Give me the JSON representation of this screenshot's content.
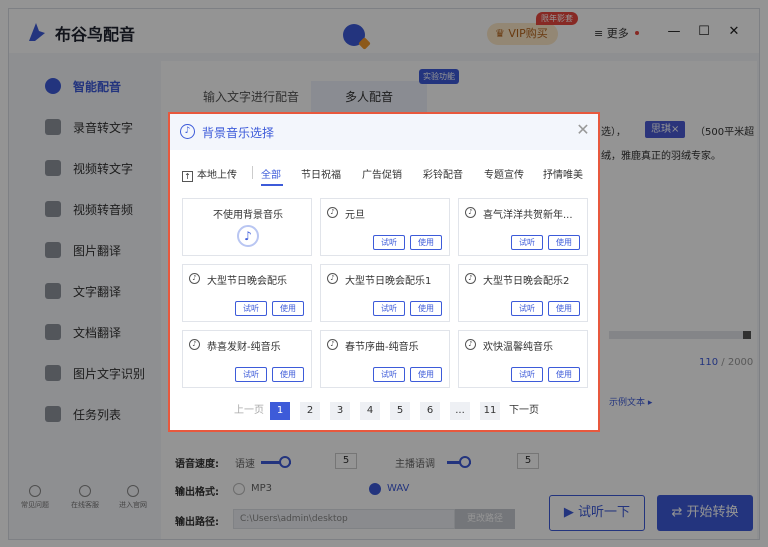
{
  "app": {
    "title": "布谷鸟配音",
    "vip_label": "VIP购买",
    "vip_tag": "限年影套",
    "more_label": "更多",
    "minimize": "—",
    "maximize": "☐",
    "close": "✕"
  },
  "sidebar": {
    "items": [
      {
        "label": "智能配音",
        "icon": "smart-dub-icon",
        "active": true
      },
      {
        "label": "录音转文字",
        "icon": "record-icon"
      },
      {
        "label": "视频转文字",
        "icon": "video-text-icon"
      },
      {
        "label": "视频转音频",
        "icon": "video-audio-icon"
      },
      {
        "label": "图片翻译",
        "icon": "image-translate-icon"
      },
      {
        "label": "文字翻译",
        "icon": "text-translate-icon"
      },
      {
        "label": "文档翻译",
        "icon": "doc-translate-icon"
      },
      {
        "label": "图片文字识别",
        "icon": "ocr-icon"
      },
      {
        "label": "任务列表",
        "icon": "task-list-icon"
      }
    ],
    "bottom": [
      {
        "label": "常见问题",
        "icon": "help-icon"
      },
      {
        "label": "在线客服",
        "icon": "service-icon"
      },
      {
        "label": "进入官网",
        "icon": "website-icon"
      }
    ]
  },
  "main": {
    "tabs": [
      {
        "label": "输入文字进行配音"
      },
      {
        "label": "多人配音",
        "selected": true
      }
    ],
    "lab_tag": "实验功能",
    "bg_text_1": "选），",
    "chip": "思琪×",
    "bg_text_2": "（500平米超",
    "bg_text_3": "绒，雅鹿真正的羽绒专家。",
    "counter_current": "110",
    "counter_total": "/ 2000",
    "example_link": "示例文本 ▸",
    "speed_label": "语音速度:",
    "speed_sub": "语速",
    "speed_value": "5",
    "pitch_sub": "主播语调",
    "pitch_value": "5",
    "format_label": "输出格式:",
    "format_mp3": "MP3",
    "format_wav": "WAV",
    "path_label": "输出路径:",
    "path_value": "C:\\Users\\admin\\desktop",
    "path_button": "更改路径",
    "listen_button": "▶  试听一下",
    "start_button": "开始转换"
  },
  "dialog": {
    "title": "背景音乐选择",
    "upload_label": "本地上传",
    "categories": [
      "全部",
      "节日祝福",
      "广告促销",
      "彩铃配音",
      "专题宣传",
      "抒情唯美"
    ],
    "selected_category": "全部",
    "no_music_label": "不使用背景音乐",
    "listen_label": "试听",
    "use_label": "使用",
    "tracks": [
      "元旦",
      "喜气洋洋共贺新年...",
      "大型节日晚会配乐",
      "大型节日晚会配乐1",
      "大型节日晚会配乐2",
      "恭喜发财-纯音乐",
      "春节序曲-纯音乐",
      "欢快温馨纯音乐"
    ],
    "pagination": {
      "prev": "上一页",
      "pages": [
        "1",
        "2",
        "3",
        "4",
        "5",
        "6",
        "...",
        "11"
      ],
      "current": "1",
      "next": "下一页"
    }
  }
}
